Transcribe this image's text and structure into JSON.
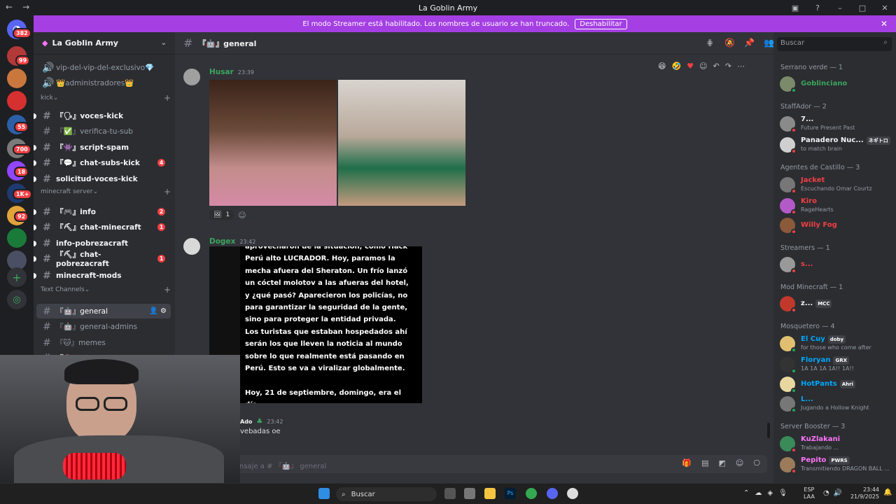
{
  "window": {
    "title": "La Goblin Army"
  },
  "banner": {
    "text": "El modo Streamer está habilitado. Los nombres de usuario se han truncado.",
    "button": "Deshabilitar"
  },
  "guilds": {
    "badges": [
      "382",
      "99",
      "55",
      "700",
      "18",
      "1K+",
      "92"
    ]
  },
  "server": {
    "name": "La Goblin Army"
  },
  "channels": [
    {
      "label": "vip-del-vip-del-exclusivo💎",
      "kind": "voice"
    },
    {
      "label": "👑administradores👑",
      "kind": "voice"
    },
    {
      "label": "kick",
      "kind": "category"
    },
    {
      "label": "『🗣』voces-kick",
      "kind": "text",
      "bright": true
    },
    {
      "label": "『✅』verifica-tu-sub",
      "kind": "text"
    },
    {
      "label": "『👾』script-spam",
      "kind": "text",
      "bright": true
    },
    {
      "label": "『💬』chat-subs-kick",
      "kind": "text",
      "bright": true,
      "badge": "4"
    },
    {
      "label": "solicitud-voces-kick",
      "kind": "text",
      "bright": true
    },
    {
      "label": "minecraft server",
      "kind": "category"
    },
    {
      "label": "『🎮』info",
      "kind": "text",
      "bright": true,
      "badge": "2"
    },
    {
      "label": "『⛏』chat-minecraft",
      "kind": "text",
      "bright": true,
      "badge": "1"
    },
    {
      "label": "info-pobrezacraft",
      "kind": "text",
      "bright": true
    },
    {
      "label": "『⛏』chat-pobrezacraft",
      "kind": "text",
      "bright": true,
      "badge": "1"
    },
    {
      "label": "minecraft-mods",
      "kind": "text",
      "bright": true
    },
    {
      "label": "Text Channels",
      "kind": "category"
    },
    {
      "label": "『🤖』general",
      "kind": "text",
      "selected": true
    },
    {
      "label": "『🤖』general-admins",
      "kind": "text"
    },
    {
      "label": "『🐱』memes",
      "kind": "text"
    },
    {
      "label": "『🎰』ludopatia",
      "kind": "text",
      "bright": true
    }
  ],
  "header": {
    "channel": "『🤖』general",
    "search_placeholder": "Buscar"
  },
  "messages": [
    {
      "author": "Husar",
      "time": "23:39",
      "reaction_count": "1"
    },
    {
      "author": "Dogex",
      "time": "23:42",
      "text": [
        "aprovecharon de la situación, como Hack",
        "Perú alto LUCRADOR. Hoy, paramos la",
        "mecha afuera del Sheraton. Un frío lanzó",
        "un cóctel molotov a las afueras del hotel,",
        "y ¿qué pasó? Aparecieron los policías, no",
        "para garantizar la seguridad de la gente,",
        "sino para proteger la entidad privada.",
        "Los turistas que estaban hospedados ahí",
        "serán los que lleven la noticia al mundo",
        "sobre lo que realmente está pasando en",
        "Perú. Esto se va a viralizar globalmente.",
        "",
        "Hoy, 21 de septiembre, domingo, era el",
        "día ... ..."
      ]
    },
    {
      "author": "Ado",
      "time": "23:42",
      "text": "vebadas oe"
    }
  ],
  "composer": {
    "placeholder": "nsaje a # 『🤖』 general"
  },
  "members": {
    "groups": [
      {
        "title": "Serrano verde — 1",
        "items": [
          {
            "name": "Goblinciano",
            "sub": "",
            "color": "#3ba55d"
          }
        ]
      },
      {
        "title": "StaffAdor — 2",
        "items": [
          {
            "name": "7...",
            "sub": "Future Present Past",
            "color": "#f2f3f5"
          },
          {
            "name": "Panadero Nuc...",
            "sub": "to match brain",
            "color": "#f2f3f5",
            "tag": "ネギトロ"
          }
        ]
      },
      {
        "title": "Agentes de Castillo — 3",
        "items": [
          {
            "name": "Jacket",
            "sub": "Escuchando Omar Courtz",
            "color": "#f23f43"
          },
          {
            "name": "Kiro",
            "sub": "RageHearts",
            "color": "#f23f43"
          },
          {
            "name": "Willy Fog",
            "sub": "",
            "color": "#f23f43"
          }
        ]
      },
      {
        "title": "Streamers — 1",
        "items": [
          {
            "name": "s...",
            "sub": "",
            "color": "#f23f43"
          }
        ]
      },
      {
        "title": "Mod Minecraft — 1",
        "items": [
          {
            "name": "z...",
            "sub": "",
            "color": "#f2f3f5",
            "tag": "MCC"
          }
        ]
      },
      {
        "title": "Mosquetero — 4",
        "items": [
          {
            "name": "El Cuy",
            "sub": "for those who come after",
            "color": "#00a8fc",
            "tag": "doby"
          },
          {
            "name": "Floryan",
            "sub": "1A 1A 1A 1A!! 1A!!",
            "color": "#00a8fc",
            "tag": "GRX"
          },
          {
            "name": "HotPants",
            "sub": "",
            "color": "#00a8fc",
            "tag": "Ahri"
          },
          {
            "name": "L...",
            "sub": "Jugando a Hollow Knight",
            "color": "#00a8fc"
          }
        ]
      },
      {
        "title": "Server Booster — 3",
        "items": [
          {
            "name": "KuZlakani",
            "sub": "Trabajando ...",
            "color": "#ff73fa"
          },
          {
            "name": "Pepito",
            "sub": "Transmitiendo DRAGON BALL ...",
            "color": "#ff73fa",
            "tag": "PWRS"
          }
        ]
      }
    ]
  },
  "taskbar": {
    "search": "Buscar",
    "lang": "ESP",
    "lang2": "LAA",
    "time": "23:44",
    "date": "21/9/2025"
  }
}
